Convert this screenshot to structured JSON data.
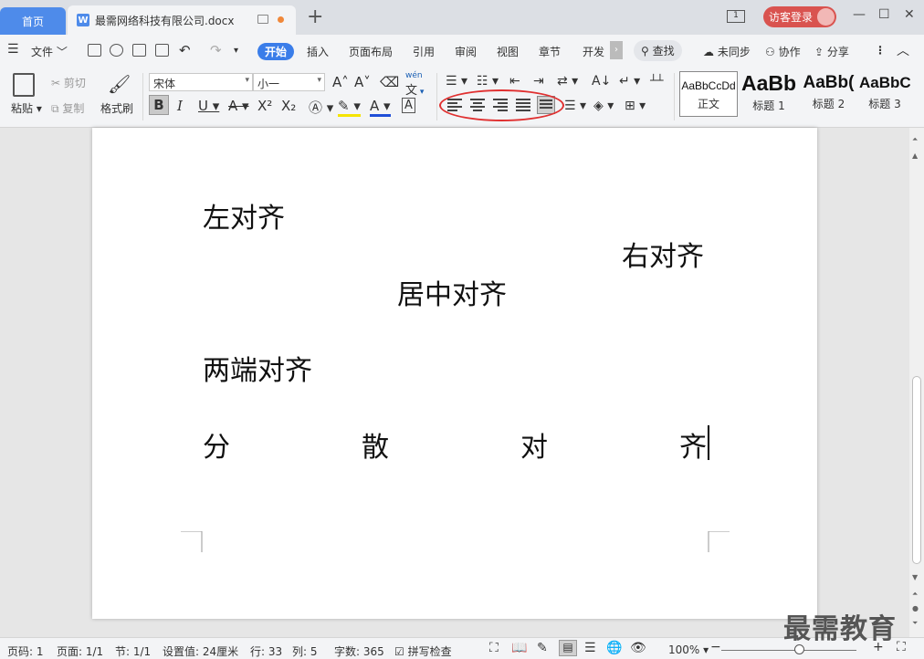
{
  "tabs": {
    "home": "首页",
    "doc_title": "最需网络科技有限公司.docx",
    "doc_icon": "W",
    "new_tab": "+"
  },
  "titlebar": {
    "page_badge": "1",
    "login": "访客登录"
  },
  "menu": {
    "file": "文件",
    "items": [
      "开始",
      "插入",
      "页面布局",
      "引用",
      "审阅",
      "视图",
      "章节",
      "开发"
    ],
    "search": "查找",
    "sync": "未同步",
    "collab": "协作",
    "share": "分享"
  },
  "ribbon": {
    "paste": "粘贴",
    "cut": "剪切",
    "copy": "复制",
    "format_painter": "格式刷",
    "font_name": "宋体",
    "font_size": "小一",
    "pinyin_top": "wén",
    "styles": [
      {
        "sample": "AaBbCcDd",
        "name": "正文"
      },
      {
        "sample": "AaBb",
        "name": "标题 1"
      },
      {
        "sample": "AaBb(",
        "name": "标题 2"
      },
      {
        "sample": "AaBbC",
        "name": "标题 3"
      }
    ]
  },
  "document": {
    "left": "左对齐",
    "right": "右对齐",
    "center": "居中对齐",
    "justify": "两端对齐",
    "distributed": [
      "分",
      "散",
      "对",
      "齐"
    ]
  },
  "statusbar": {
    "page_no": "页码: 1",
    "pages": "页面: 1/1",
    "section": "节: 1/1",
    "setting": "设置值: 24厘米",
    "row": "行: 33",
    "col": "列: 5",
    "words": "字数: 365",
    "spell": "拼写检查",
    "zoom": "100%"
  },
  "watermark": "最需教育",
  "colors": {
    "accent": "#3a7de9",
    "home_tab": "#4e8bea",
    "login": "#d9534f",
    "circle": "#e03030"
  },
  "icons": [
    "monitor-icon",
    "unsaved-dot-icon",
    "save-icon",
    "print-icon",
    "undo-icon",
    "redo-icon",
    "search-icon",
    "cloud-icon",
    "user-icon",
    "share-icon",
    "paste-icon",
    "scissors-icon",
    "copy-icon",
    "brush-icon",
    "align-left-icon",
    "align-center-icon",
    "align-right-icon",
    "justify-icon",
    "distribute-icon"
  ]
}
